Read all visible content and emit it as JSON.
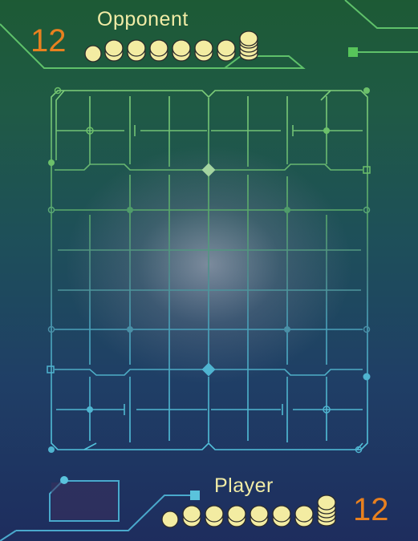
{
  "opponent": {
    "name": "Opponent",
    "count": "12"
  },
  "player": {
    "name": "Player",
    "count": "12"
  },
  "colors": {
    "board_top": "#6cc06a",
    "board_bottom": "#47b6d2",
    "coin": "#f3eca2",
    "count": "#e8801f",
    "label": "#f1eca6"
  },
  "board": {
    "columns": 9,
    "rows": 9
  }
}
